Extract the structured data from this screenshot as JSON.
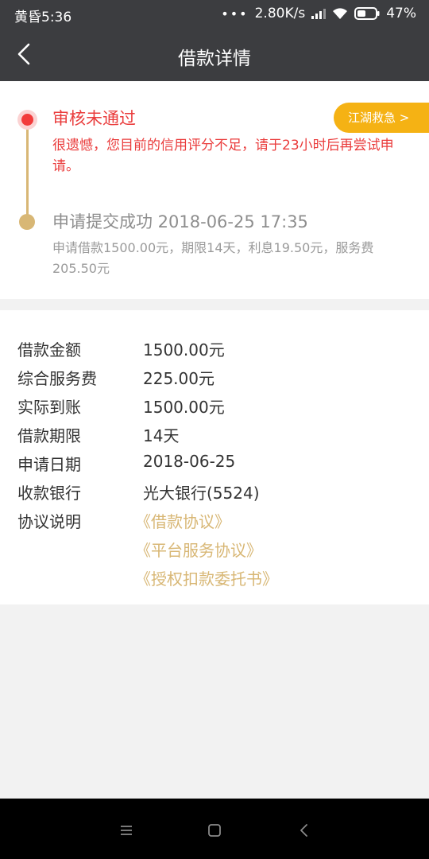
{
  "status_bar": {
    "time": "黄昏5:36",
    "dots": "•••",
    "speed": "2.80K/s",
    "battery": "47%"
  },
  "nav": {
    "title": "借款详情"
  },
  "timeline": {
    "current": {
      "title": "审核未通过",
      "desc": "很遗憾，您目前的信用评分不足，请于23小时后再尝试申请。",
      "action_label": "江湖救急 >"
    },
    "previous": {
      "title": "申请提交成功 2018-06-25 17:35",
      "desc": "申请借款1500.00元，期限14天，利息19.50元，服务费205.50元"
    }
  },
  "details": {
    "rows": [
      {
        "label": "借款金额",
        "value": "1500.00元"
      },
      {
        "label": "综合服务费",
        "value": "225.00元"
      },
      {
        "label": "实际到账",
        "value": "1500.00元"
      },
      {
        "label": "借款期限",
        "value": "14天"
      },
      {
        "label": "申请日期",
        "value": "2018-06-25"
      },
      {
        "label": "收款银行",
        "value": "光大银行(5524)"
      }
    ],
    "agreements_label": "协议说明",
    "agreements": [
      "《借款协议》",
      "《平台服务协议》",
      "《授权扣款委托书》"
    ]
  },
  "colors": {
    "bar": "#3c3d40",
    "alert": "#ea3c3c",
    "gold": "#d8b775",
    "button": "#f5b214"
  },
  "icons": {
    "back": "chevron-left-icon",
    "signal": "signal-icon",
    "wifi": "wifi-icon",
    "battery": "battery-icon",
    "menu": "menu-icon",
    "home": "home-icon",
    "sys_back": "back-icon"
  }
}
